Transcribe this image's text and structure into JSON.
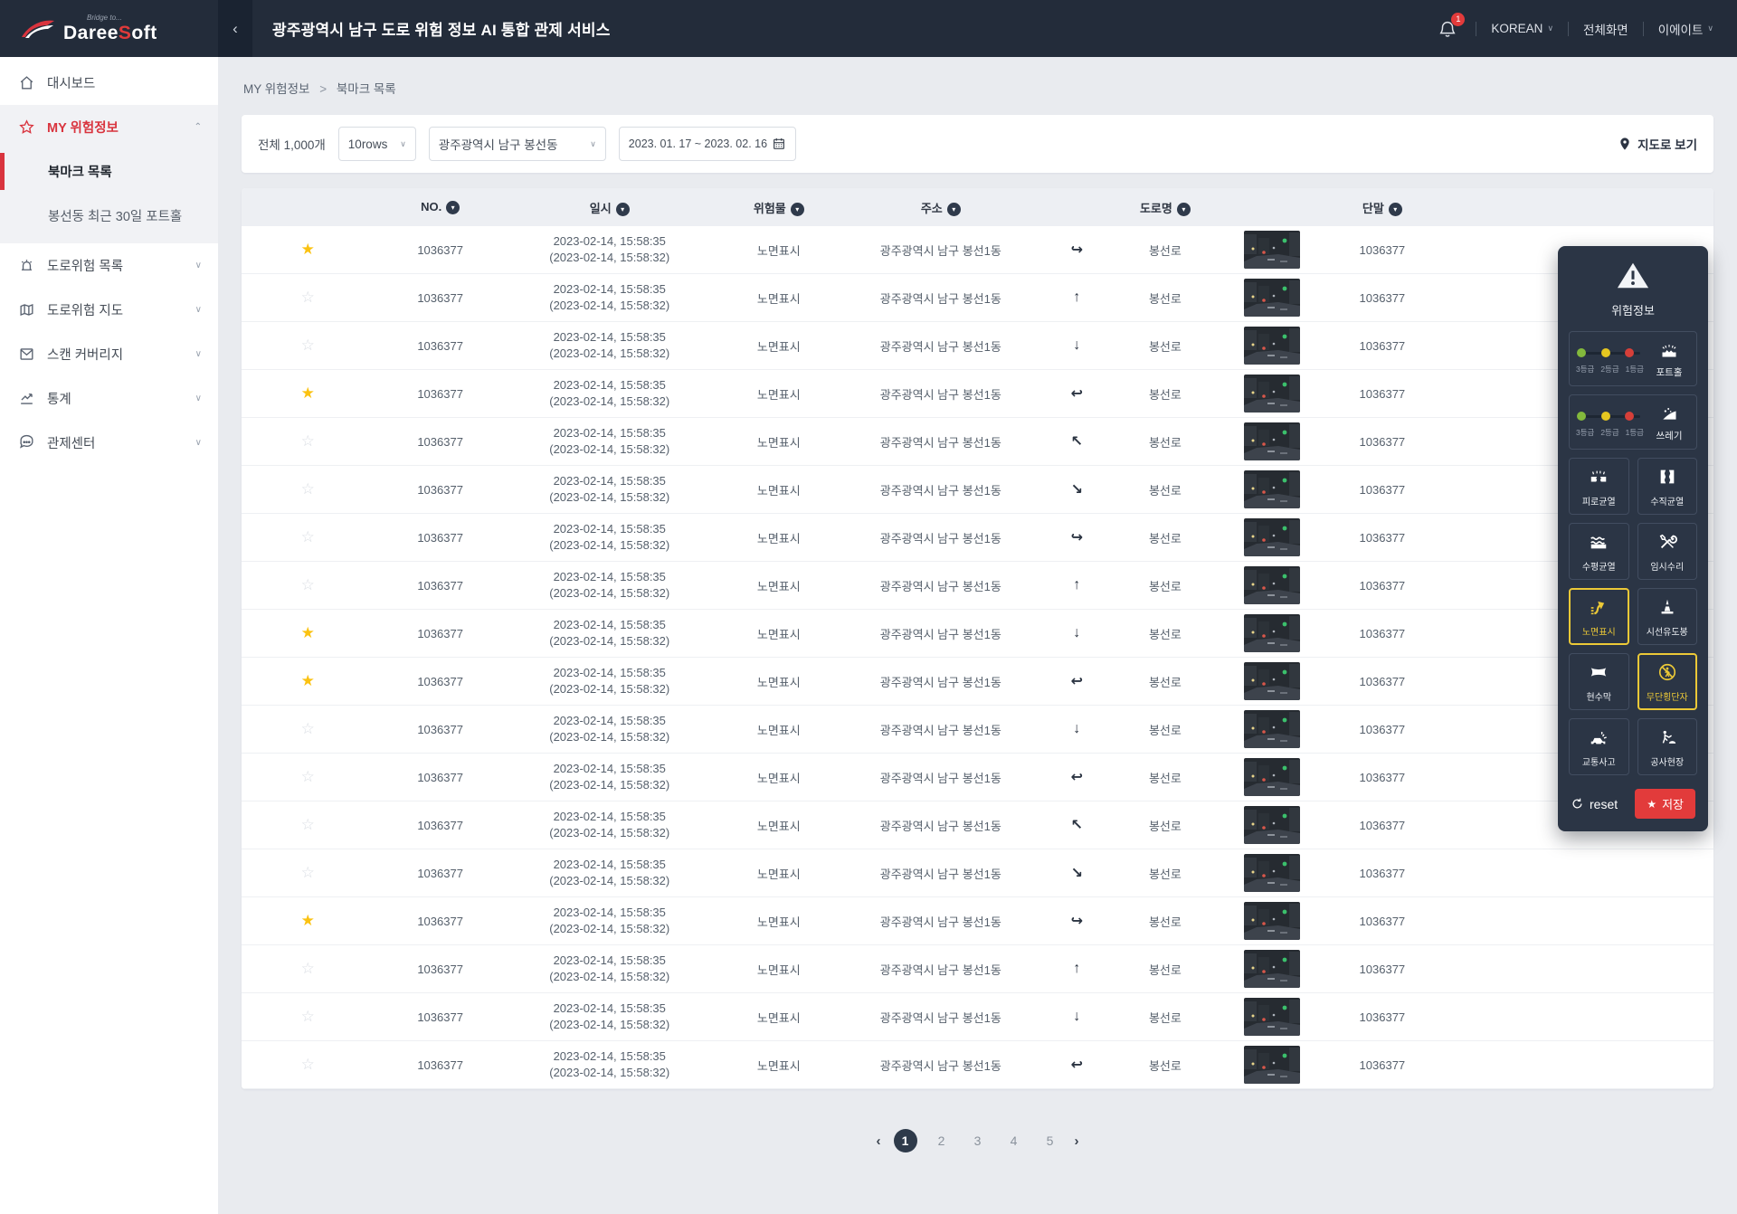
{
  "header": {
    "logo_top": "Bridge to...",
    "logo_main_a": "Daree",
    "logo_main_b": "S",
    "logo_main_c": "oft",
    "title": "광주광역시 남구 도로 위험 정보 AI 통합 관제 서비스",
    "collapse_glyph": "‹",
    "notification_count": "1",
    "language": "KOREAN",
    "fullscreen_label": "전체화면",
    "user_label": "이에이트"
  },
  "sidebar": {
    "dashboard": "대시보드",
    "my_hazard": "MY 위험정보",
    "bookmark_list": "북마크 목록",
    "recent_pothole": "봉선동 최근 30일 포트홀",
    "hazard_list": "도로위험 목록",
    "hazard_map": "도로위험 지도",
    "scan_coverage": "스캔 커버리지",
    "statistics": "통계",
    "control_center": "관제센터"
  },
  "breadcrumb": {
    "parent": "MY 위험정보",
    "separator": ">",
    "current": "북마크 목록"
  },
  "filters": {
    "total_label": "전체 1,000개",
    "rows_select": "10rows",
    "region_select": "광주광역시 남구 봉선동",
    "date_range": "2023. 01. 17 ~ 2023. 02. 16",
    "map_view_label": "지도로 보기"
  },
  "table": {
    "columns": [
      {
        "label": "",
        "cls": "c-star",
        "sortable": false
      },
      {
        "label": "NO.",
        "cls": "c-no",
        "sortable": true
      },
      {
        "label": "일시",
        "cls": "c-date",
        "sortable": true
      },
      {
        "label": "위험물",
        "cls": "c-hz",
        "sortable": true
      },
      {
        "label": "주소",
        "cls": "c-addr",
        "sortable": true
      },
      {
        "label": "",
        "cls": "c-dir",
        "sortable": false
      },
      {
        "label": "도로명",
        "cls": "c-road",
        "sortable": true
      },
      {
        "label": "",
        "cls": "c-thumb",
        "sortable": false
      },
      {
        "label": "단말",
        "cls": "c-dev",
        "sortable": true
      }
    ],
    "rows": [
      {
        "bookmarked": true,
        "no": "1036377",
        "time": "2023-02-14, 15:58:35",
        "time_sub": "(2023-02-14, 15:58:32)",
        "hazard": "노면표시",
        "address": "광주광역시 남구 봉선1동",
        "direction": "↪",
        "road": "봉선로",
        "device": "1036377"
      },
      {
        "bookmarked": false,
        "no": "1036377",
        "time": "2023-02-14, 15:58:35",
        "time_sub": "(2023-02-14, 15:58:32)",
        "hazard": "노면표시",
        "address": "광주광역시 남구 봉선1동",
        "direction": "↑",
        "road": "봉선로",
        "device": "1036377"
      },
      {
        "bookmarked": false,
        "no": "1036377",
        "time": "2023-02-14, 15:58:35",
        "time_sub": "(2023-02-14, 15:58:32)",
        "hazard": "노면표시",
        "address": "광주광역시 남구 봉선1동",
        "direction": "↓",
        "road": "봉선로",
        "device": "1036377"
      },
      {
        "bookmarked": true,
        "no": "1036377",
        "time": "2023-02-14, 15:58:35",
        "time_sub": "(2023-02-14, 15:58:32)",
        "hazard": "노면표시",
        "address": "광주광역시 남구 봉선1동",
        "direction": "↩",
        "road": "봉선로",
        "device": "1036377"
      },
      {
        "bookmarked": false,
        "no": "1036377",
        "time": "2023-02-14, 15:58:35",
        "time_sub": "(2023-02-14, 15:58:32)",
        "hazard": "노면표시",
        "address": "광주광역시 남구 봉선1동",
        "direction": "↖",
        "road": "봉선로",
        "device": "1036377"
      },
      {
        "bookmarked": false,
        "no": "1036377",
        "time": "2023-02-14, 15:58:35",
        "time_sub": "(2023-02-14, 15:58:32)",
        "hazard": "노면표시",
        "address": "광주광역시 남구 봉선1동",
        "direction": "↘",
        "road": "봉선로",
        "device": "1036377"
      },
      {
        "bookmarked": false,
        "no": "1036377",
        "time": "2023-02-14, 15:58:35",
        "time_sub": "(2023-02-14, 15:58:32)",
        "hazard": "노면표시",
        "address": "광주광역시 남구 봉선1동",
        "direction": "↪",
        "road": "봉선로",
        "device": "1036377"
      },
      {
        "bookmarked": false,
        "no": "1036377",
        "time": "2023-02-14, 15:58:35",
        "time_sub": "(2023-02-14, 15:58:32)",
        "hazard": "노면표시",
        "address": "광주광역시 남구 봉선1동",
        "direction": "↑",
        "road": "봉선로",
        "device": "1036377"
      },
      {
        "bookmarked": true,
        "no": "1036377",
        "time": "2023-02-14, 15:58:35",
        "time_sub": "(2023-02-14, 15:58:32)",
        "hazard": "노면표시",
        "address": "광주광역시 남구 봉선1동",
        "direction": "↓",
        "road": "봉선로",
        "device": "1036377"
      },
      {
        "bookmarked": true,
        "no": "1036377",
        "time": "2023-02-14, 15:58:35",
        "time_sub": "(2023-02-14, 15:58:32)",
        "hazard": "노면표시",
        "address": "광주광역시 남구 봉선1동",
        "direction": "↩",
        "road": "봉선로",
        "device": "1036377"
      },
      {
        "bookmarked": false,
        "no": "1036377",
        "time": "2023-02-14, 15:58:35",
        "time_sub": "(2023-02-14, 15:58:32)",
        "hazard": "노면표시",
        "address": "광주광역시 남구 봉선1동",
        "direction": "↓",
        "road": "봉선로",
        "device": "1036377"
      },
      {
        "bookmarked": false,
        "no": "1036377",
        "time": "2023-02-14, 15:58:35",
        "time_sub": "(2023-02-14, 15:58:32)",
        "hazard": "노면표시",
        "address": "광주광역시 남구 봉선1동",
        "direction": "↩",
        "road": "봉선로",
        "device": "1036377"
      },
      {
        "bookmarked": false,
        "no": "1036377",
        "time": "2023-02-14, 15:58:35",
        "time_sub": "(2023-02-14, 15:58:32)",
        "hazard": "노면표시",
        "address": "광주광역시 남구 봉선1동",
        "direction": "↖",
        "road": "봉선로",
        "device": "1036377"
      },
      {
        "bookmarked": false,
        "no": "1036377",
        "time": "2023-02-14, 15:58:35",
        "time_sub": "(2023-02-14, 15:58:32)",
        "hazard": "노면표시",
        "address": "광주광역시 남구 봉선1동",
        "direction": "↘",
        "road": "봉선로",
        "device": "1036377"
      },
      {
        "bookmarked": true,
        "no": "1036377",
        "time": "2023-02-14, 15:58:35",
        "time_sub": "(2023-02-14, 15:58:32)",
        "hazard": "노면표시",
        "address": "광주광역시 남구 봉선1동",
        "direction": "↪",
        "road": "봉선로",
        "device": "1036377"
      },
      {
        "bookmarked": false,
        "no": "1036377",
        "time": "2023-02-14, 15:58:35",
        "time_sub": "(2023-02-14, 15:58:32)",
        "hazard": "노면표시",
        "address": "광주광역시 남구 봉선1동",
        "direction": "↑",
        "road": "봉선로",
        "device": "1036377"
      },
      {
        "bookmarked": false,
        "no": "1036377",
        "time": "2023-02-14, 15:58:35",
        "time_sub": "(2023-02-14, 15:58:32)",
        "hazard": "노면표시",
        "address": "광주광역시 남구 봉선1동",
        "direction": "↓",
        "road": "봉선로",
        "device": "1036377"
      },
      {
        "bookmarked": false,
        "no": "1036377",
        "time": "2023-02-14, 15:58:35",
        "time_sub": "(2023-02-14, 15:58:32)",
        "hazard": "노면표시",
        "address": "광주광역시 남구 봉선1동",
        "direction": "↩",
        "road": "봉선로",
        "device": "1036377"
      }
    ]
  },
  "pagination": {
    "prev": "‹",
    "next": "›",
    "pages": [
      "1",
      "2",
      "3",
      "4",
      "5"
    ],
    "active": "1"
  },
  "hazard_panel": {
    "title": "위험정보",
    "grade_labels": [
      "3등급",
      "2등급",
      "1등급"
    ],
    "slider_items": [
      {
        "label": "포트홀",
        "icon": "pothole-icon"
      },
      {
        "label": "쓰레기",
        "icon": "trash-icon"
      }
    ],
    "grid_items": [
      {
        "label": "피로균열",
        "icon": "fatigue-crack-icon",
        "selected": false
      },
      {
        "label": "수직균열",
        "icon": "vertical-crack-icon",
        "selected": false
      },
      {
        "label": "수평균열",
        "icon": "horizontal-crack-icon",
        "selected": false
      },
      {
        "label": "임시수리",
        "icon": "temp-repair-icon",
        "selected": false
      },
      {
        "label": "노면표시",
        "icon": "road-marking-icon",
        "selected": true
      },
      {
        "label": "시선유도봉",
        "icon": "delineator-icon",
        "selected": false
      },
      {
        "label": "현수막",
        "icon": "banner-icon",
        "selected": false
      },
      {
        "label": "무단횡단자",
        "icon": "jaywalker-icon",
        "selected": true
      },
      {
        "label": "교통사고",
        "icon": "accident-icon",
        "selected": false
      },
      {
        "label": "공사현장",
        "icon": "construction-icon",
        "selected": false
      }
    ],
    "reset_label": "reset",
    "save_label": "저장"
  },
  "icons": {
    "star_filled": "★",
    "star_empty": "☆",
    "chevron_down": "⌄",
    "chevron_up": "⌃",
    "sort_glyph": "▾",
    "save_star": "★"
  },
  "colors": {
    "header_bg": "#232c3a",
    "accent_red": "#d9343e",
    "save_red": "#e23b3b",
    "panel_bg": "#2b3545",
    "highlight_yellow": "#ecc937",
    "star_yellow": "#fbc211",
    "grade_green": "#83b93c",
    "grade_yellow": "#e5c620",
    "grade_red": "#d63f39"
  }
}
